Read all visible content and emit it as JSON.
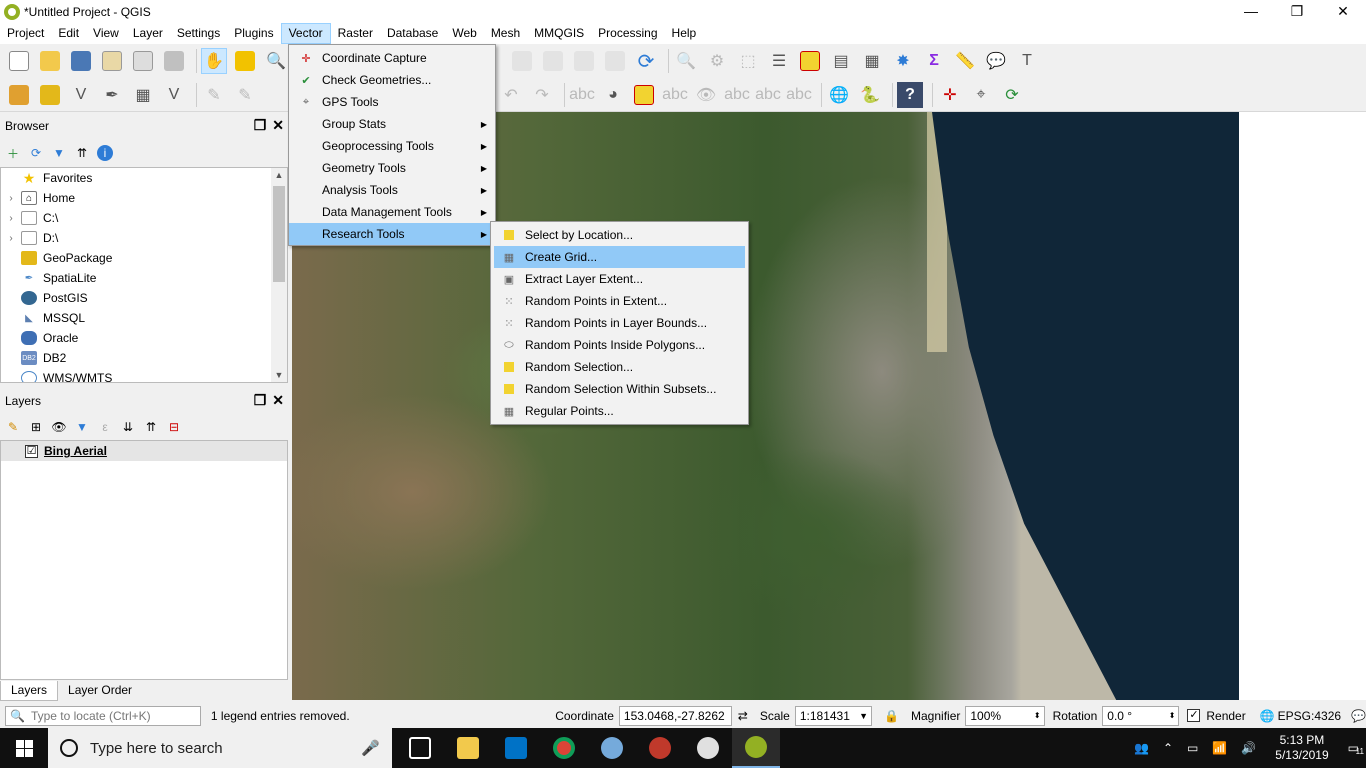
{
  "window": {
    "title": "*Untitled Project - QGIS",
    "controls": [
      "—",
      "❐",
      "✕"
    ]
  },
  "menubar": [
    "Project",
    "Edit",
    "View",
    "Layer",
    "Settings",
    "Plugins",
    "Vector",
    "Raster",
    "Database",
    "Web",
    "Mesh",
    "MMQGIS",
    "Processing",
    "Help"
  ],
  "vector_menu": [
    {
      "label": "Coordinate Capture",
      "icon": "✛",
      "submenu": false
    },
    {
      "label": "Check Geometries...",
      "icon": "✔",
      "submenu": false
    },
    {
      "label": "GPS Tools",
      "icon": "⌖",
      "submenu": false
    },
    {
      "label": "Group Stats",
      "icon": "",
      "submenu": true
    },
    {
      "label": "Geoprocessing Tools",
      "icon": "",
      "submenu": true
    },
    {
      "label": "Geometry Tools",
      "icon": "",
      "submenu": true
    },
    {
      "label": "Analysis Tools",
      "icon": "",
      "submenu": true
    },
    {
      "label": "Data Management Tools",
      "icon": "",
      "submenu": true
    },
    {
      "label": "Research Tools",
      "icon": "",
      "submenu": true
    }
  ],
  "research_menu": [
    {
      "label": "Select by Location...",
      "icon": "■"
    },
    {
      "label": "Create Grid...",
      "icon": "▦"
    },
    {
      "label": "Extract Layer Extent...",
      "icon": "▣"
    },
    {
      "label": "Random Points in Extent...",
      "icon": "⁙"
    },
    {
      "label": "Random Points in Layer Bounds...",
      "icon": "⁙"
    },
    {
      "label": "Random Points Inside Polygons...",
      "icon": "⬭"
    },
    {
      "label": "Random Selection...",
      "icon": "■"
    },
    {
      "label": "Random Selection Within Subsets...",
      "icon": "■"
    },
    {
      "label": "Regular Points...",
      "icon": "▦"
    }
  ],
  "browser": {
    "title": "Browser",
    "items": [
      {
        "label": "Favorites",
        "icon": "★",
        "color": "#f2c200",
        "arrow": ""
      },
      {
        "label": "Home",
        "icon": "⌂",
        "color": "#777777",
        "arrow": "›"
      },
      {
        "label": "C:\\",
        "icon": "▭",
        "color": "#999999",
        "arrow": "›"
      },
      {
        "label": "D:\\",
        "icon": "▭",
        "color": "#999999",
        "arrow": "›"
      },
      {
        "label": "GeoPackage",
        "icon": "◆",
        "color": "#e3b81a",
        "arrow": ""
      },
      {
        "label": "SpatiaLite",
        "icon": "✒",
        "color": "#4a86c7",
        "arrow": ""
      },
      {
        "label": "PostGIS",
        "icon": "🐘",
        "color": "#336791",
        "arrow": ""
      },
      {
        "label": "MSSQL",
        "icon": "◣",
        "color": "#5d7fb0",
        "arrow": ""
      },
      {
        "label": "Oracle",
        "icon": "⬭",
        "color": "#3f6fb4",
        "arrow": ""
      },
      {
        "label": "DB2",
        "icon": "DB2",
        "color": "#6b8cc2",
        "arrow": ""
      },
      {
        "label": "WMS/WMTS",
        "icon": "◎",
        "color": "#4a86c7",
        "arrow": ""
      }
    ]
  },
  "layers": {
    "title": "Layers",
    "items": [
      {
        "label": "Bing Aerial",
        "checked": "☑"
      }
    ]
  },
  "bottom_tabs": [
    "Layers",
    "Layer Order"
  ],
  "statusbar": {
    "locate_placeholder": "Type to locate (Ctrl+K)",
    "message": "1 legend entries removed.",
    "coordinate_label": "Coordinate",
    "coordinate_value": "153.0468,-27.8262",
    "scale_label": "Scale",
    "scale_value": "1:181431",
    "magnifier_label": "Magnifier",
    "magnifier_value": "100%",
    "rotation_label": "Rotation",
    "rotation_value": "0.0 °",
    "render_label": "Render",
    "crs": "EPSG:4326"
  },
  "taskbar": {
    "search_placeholder": "Type here to search",
    "time": "5:13 PM",
    "date": "5/13/2019",
    "notifications": "11"
  },
  "colors": {
    "menu_highlight": "#91c9f7",
    "active_menu": "#cce8ff",
    "ocean": "#102638"
  }
}
